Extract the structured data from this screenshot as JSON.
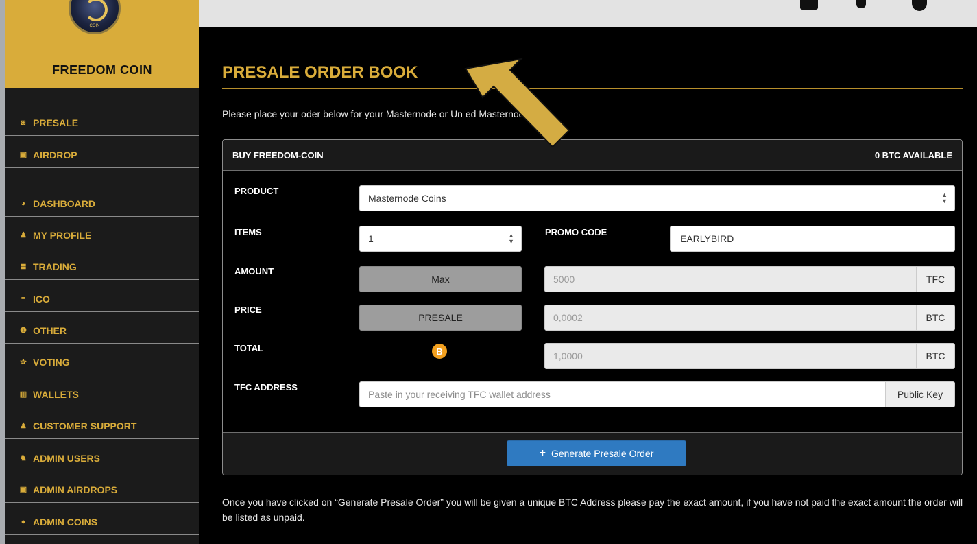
{
  "brand": {
    "name": "FREEDOM COIN",
    "logo_text": "COIN"
  },
  "sidebar": {
    "items": [
      {
        "label": "PRESALE",
        "icon": "money-icon",
        "glyph": "◙"
      },
      {
        "label": "AIRDROP",
        "icon": "gift-icon",
        "glyph": "▣"
      },
      {
        "label": "DASHBOARD",
        "icon": "dashboard-icon",
        "glyph": "◕"
      },
      {
        "label": "MY PROFILE",
        "icon": "user-icon",
        "glyph": "♟"
      },
      {
        "label": "TRADING",
        "icon": "list-icon",
        "glyph": "≣"
      },
      {
        "label": "ICO",
        "icon": "database-icon",
        "glyph": "≡"
      },
      {
        "label": "OTHER",
        "icon": "info-icon",
        "glyph": "❶"
      },
      {
        "label": "VOTING",
        "icon": "star-icon",
        "glyph": "✰"
      },
      {
        "label": "WALLETS",
        "icon": "bank-icon",
        "glyph": "▥"
      },
      {
        "label": "CUSTOMER SUPPORT",
        "icon": "user-icon",
        "glyph": "♟"
      },
      {
        "label": "ADMIN USERS",
        "icon": "users-icon",
        "glyph": "♞"
      },
      {
        "label": "ADMIN AIRDROPS",
        "icon": "gift-icon",
        "glyph": "▣"
      },
      {
        "label": "ADMIN COINS",
        "icon": "circle-icon",
        "glyph": "●"
      }
    ]
  },
  "main": {
    "title": "PRESALE ORDER BOOK",
    "intro": "Please place your oder below for your Masternode or Un            ed Masternode.",
    "panel": {
      "header_left": "BUY FREEDOM-COIN",
      "header_right": "0 BTC AVAILABLE",
      "product_label": "PRODUCT",
      "product_value": "Masternode Coins",
      "items_label": "ITEMS",
      "items_value": "1",
      "promo_label": "PROMO CODE",
      "promo_value": "EARLYBIRD",
      "amount_label": "AMOUNT",
      "amount_button": "Max",
      "amount_value": "5000",
      "amount_unit": "TFC",
      "price_label": "PRICE",
      "price_button": "PRESALE",
      "price_value": "0,0002",
      "price_unit": "BTC",
      "total_label": "TOTAL",
      "total_value": "1,0000",
      "total_unit": "BTC",
      "btc_glyph": "B",
      "address_label": "TFC ADDRESS",
      "address_placeholder": "Paste in your receiving TFC wallet address",
      "address_addon": "Public Key",
      "generate_label": "Generate Presale Order"
    },
    "note": "Once you have clicked on “Generate Presale Order” you will be given a unique BTC Address please pay the exact amount, if you have not paid the exact amount the order will be listed as unpaid."
  },
  "colors": {
    "accent": "#d9ac3a",
    "primary": "#2f7ac1",
    "bitcoin": "#f2a01f",
    "arrow": "#d4ac43"
  }
}
